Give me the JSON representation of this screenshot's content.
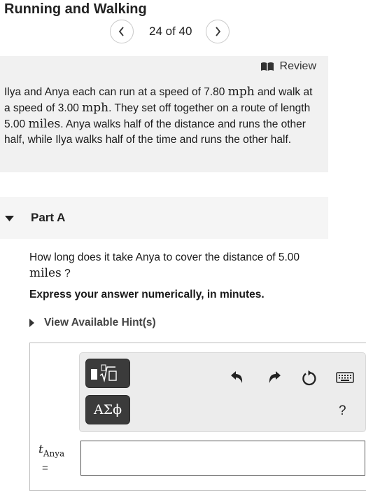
{
  "header": {
    "title": "Running and Walking",
    "position": "24 of 40"
  },
  "problem": {
    "review_label": "Review",
    "statement": [
      {
        "t": "Ilya and Anya each can run at a speed of 7.80 "
      },
      {
        "u": "mph"
      },
      {
        "t": " and walk at a speed of 3.00 "
      },
      {
        "u": "mph"
      },
      {
        "t": ". They set off together on a route of length 5.00 "
      },
      {
        "u": "miles"
      },
      {
        "t": ". Anya walks half of the distance and runs the other half, while Ilya walks half of the time and runs the other half."
      }
    ]
  },
  "part": {
    "title": "Part A",
    "question": [
      {
        "t": "How long does it take Anya to cover the distance of 5.00 "
      },
      {
        "u": "miles"
      },
      {
        "t": " ?"
      }
    ],
    "instruction": "Express your answer numerically, in minutes.",
    "hint_label": "View Available Hint(s)"
  },
  "answer": {
    "symbol_button": "ΑΣϕ",
    "help_label": "?",
    "variable": "t",
    "variable_sub": "Anya",
    "equals": "=",
    "value": ""
  },
  "icons": {
    "prev": "chevron-left-icon",
    "next": "chevron-right-icon",
    "review": "book-icon",
    "expand": "triangle-down-icon",
    "hint": "triangle-right-icon",
    "undo": "undo-arrow-icon",
    "redo": "redo-arrow-icon",
    "reset": "reset-icon",
    "keyboard": "keyboard-icon",
    "template": "fraction-radical-icon"
  }
}
